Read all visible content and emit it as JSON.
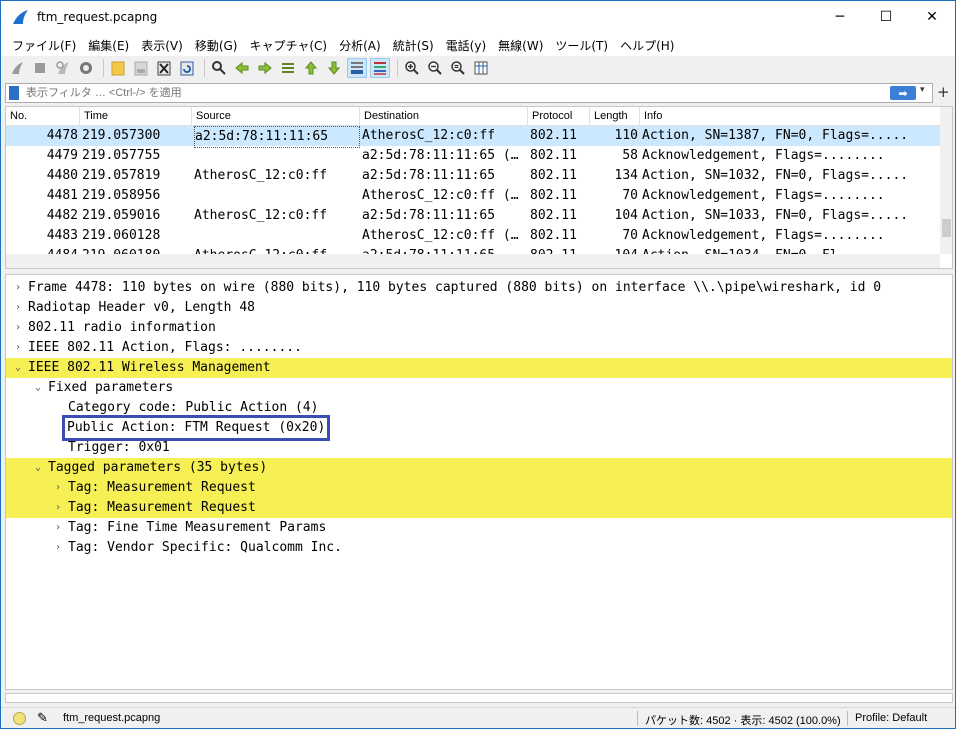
{
  "window": {
    "title": "ftm_request.pcapng",
    "minimize": "─",
    "maximize": "☐",
    "close": "✕"
  },
  "menu": [
    "ファイル(F)",
    "編集(E)",
    "表示(V)",
    "移動(G)",
    "キャプチャ(C)",
    "分析(A)",
    "統計(S)",
    "電話(y)",
    "無線(W)",
    "ツール(T)",
    "ヘルプ(H)"
  ],
  "toolbar_icons": [
    "start-capture-icon",
    "stop-capture-icon",
    "restart-capture-icon",
    "capture-options-icon",
    "open-file-icon",
    "save-file-icon",
    "close-file-icon",
    "reload-file-icon",
    "find-packet-icon",
    "go-back-icon",
    "go-forward-icon",
    "go-to-packet-icon",
    "go-first-icon",
    "go-last-icon",
    "auto-scroll-icon",
    "colorize-icon",
    "zoom-in-icon",
    "zoom-out-icon",
    "zoom-normal-icon",
    "resize-columns-icon"
  ],
  "filter": {
    "placeholder": "表示フィルタ … <Ctrl-/> を適用",
    "apply": "➡",
    "dropdown": "▾",
    "add": "+"
  },
  "packet_list": {
    "columns": [
      "No.",
      "Time",
      "Source",
      "Destination",
      "Protocol",
      "Length",
      "Info"
    ],
    "rows": [
      {
        "no": "4478",
        "time": "219.057300",
        "src": "a2:5d:78:11:11:65",
        "dst": "AtherosC_12:c0:ff",
        "proto": "802.11",
        "len": "110",
        "info": "Action, SN=1387, FN=0, Flags=....."
      },
      {
        "no": "4479",
        "time": "219.057755",
        "src": "",
        "dst": "a2:5d:78:11:11:65 (…",
        "proto": "802.11",
        "len": "58",
        "info": "Acknowledgement, Flags=........"
      },
      {
        "no": "4480",
        "time": "219.057819",
        "src": "AtherosC_12:c0:ff",
        "dst": "a2:5d:78:11:11:65",
        "proto": "802.11",
        "len": "134",
        "info": "Action, SN=1032, FN=0, Flags=....."
      },
      {
        "no": "4481",
        "time": "219.058956",
        "src": "",
        "dst": "AtherosC_12:c0:ff (…",
        "proto": "802.11",
        "len": "70",
        "info": "Acknowledgement, Flags=........"
      },
      {
        "no": "4482",
        "time": "219.059016",
        "src": "AtherosC_12:c0:ff",
        "dst": "a2:5d:78:11:11:65",
        "proto": "802.11",
        "len": "104",
        "info": "Action, SN=1033, FN=0, Flags=....."
      },
      {
        "no": "4483",
        "time": "219.060128",
        "src": "",
        "dst": "AtherosC_12:c0:ff (…",
        "proto": "802.11",
        "len": "70",
        "info": "Acknowledgement, Flags=........"
      },
      {
        "no": "4484",
        "time": "219.060180",
        "src": "AtherosC_12:c0:ff",
        "dst": "a2:5d:78:11:11:65",
        "proto": "802.11",
        "len": "104",
        "info": "Action, SN=1034, FN=0, Fl..."
      }
    ]
  },
  "details": [
    {
      "text": "Frame 4478: 110 bytes on wire (880 bits), 110 bytes captured (880 bits) on interface \\\\.\\pipe\\wireshark, id 0",
      "arrow": "›",
      "hl": false,
      "boxed": false
    },
    {
      "text": "Radiotap Header v0, Length 48",
      "arrow": "›",
      "hl": false,
      "boxed": false
    },
    {
      "text": "802.11 radio information",
      "arrow": "›",
      "hl": false,
      "boxed": false
    },
    {
      "text": "IEEE 802.11 Action, Flags: ........",
      "arrow": "›",
      "hl": false,
      "boxed": false
    },
    {
      "text": "IEEE 802.11 Wireless Management",
      "arrow": "⌄",
      "hl": true,
      "boxed": false
    },
    {
      "text": "Fixed parameters",
      "arrow": "⌄",
      "hl": false,
      "boxed": false
    },
    {
      "text": "Category code: Public Action (4)",
      "arrow": "",
      "hl": false,
      "boxed": false
    },
    {
      "text": "Public Action: FTM Request (0x20)",
      "arrow": "",
      "hl": false,
      "boxed": true
    },
    {
      "text": "Trigger: 0x01",
      "arrow": "",
      "hl": false,
      "boxed": false
    },
    {
      "text": "Tagged parameters (35 bytes)",
      "arrow": "⌄",
      "hl": true,
      "boxed": false
    },
    {
      "text": "Tag: Measurement Request",
      "arrow": "›",
      "hl": true,
      "boxed": false
    },
    {
      "text": "Tag: Measurement Request",
      "arrow": "›",
      "hl": true,
      "boxed": false
    },
    {
      "text": "Tag: Fine Time Measurement Params",
      "arrow": "›",
      "hl": false,
      "boxed": false
    },
    {
      "text": "Tag: Vendor Specific: Qualcomm Inc.",
      "arrow": "›",
      "hl": false,
      "boxed": false
    }
  ],
  "status": {
    "file": "ftm_request.pcapng",
    "stats": "パケット数: 4502 · 表示: 4502 (100.0%)",
    "profile": "Profile: Default"
  },
  "colors": {
    "selected_row": "#cce8ff",
    "highlight": "#f6f055",
    "box": "#3b4eb4"
  }
}
